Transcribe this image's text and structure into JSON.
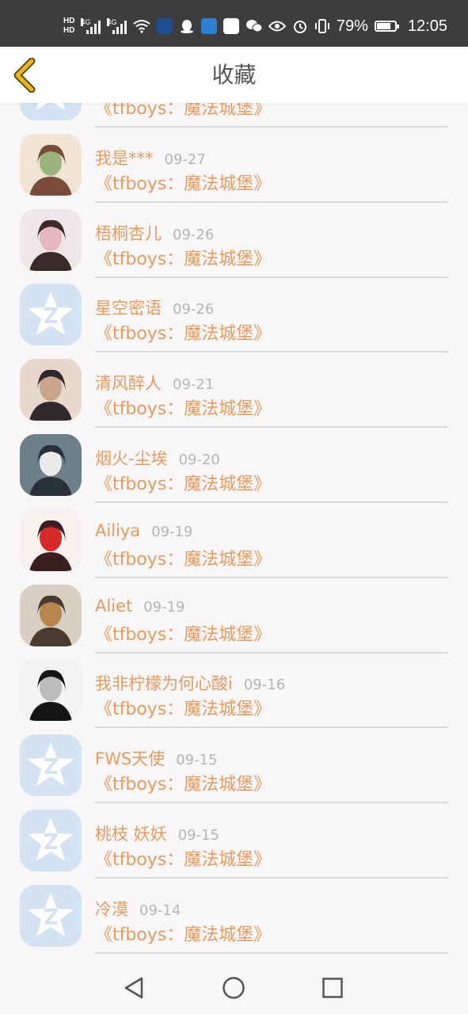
{
  "status_bar": {
    "hd1": "HD",
    "hd2": "HD",
    "sig1_label": "4G",
    "sig2_label": "4G",
    "battery_percent": "79%",
    "battery_level": 0.79,
    "time": "12:05",
    "icons": [
      "wifi-icon",
      "app-icon",
      "qq-icon",
      "app-icon",
      "app-icon",
      "wechat-icon",
      "eye-icon",
      "alarm-icon",
      "vibrate-icon",
      "battery-icon"
    ]
  },
  "header": {
    "title": "收藏",
    "back_icon": "chevron-left-icon",
    "accent": "#e8b422"
  },
  "colors": {
    "accent_orange": "#e69a5e",
    "date_gray": "#b5b5b5",
    "placeholder_avatar": "#d3e3f1"
  },
  "favorites": [
    {
      "name": "",
      "date": "",
      "book": "《tfboys：魔法城堡》",
      "avatar": "qq-default"
    },
    {
      "name": "我是***",
      "date": "09-27",
      "book": "《tfboys：魔法城堡》",
      "avatar": "photo"
    },
    {
      "name": "梧桐杏儿",
      "date": "09-26",
      "book": "《tfboys：魔法城堡》",
      "avatar": "photo"
    },
    {
      "name": "星空密语",
      "date": "09-26",
      "book": "《tfboys：魔法城堡》",
      "avatar": "qq-default"
    },
    {
      "name": "清风醉人",
      "date": "09-21",
      "book": "《tfboys：魔法城堡》",
      "avatar": "photo"
    },
    {
      "name": "烟火-尘埃",
      "date": "09-20",
      "book": "《tfboys：魔法城堡》",
      "avatar": "photo"
    },
    {
      "name": "Ailiya",
      "date": "09-19",
      "book": "《tfboys：魔法城堡》",
      "avatar": "photo"
    },
    {
      "name": "Aliet",
      "date": "09-19",
      "book": "《tfboys：魔法城堡》",
      "avatar": "photo"
    },
    {
      "name": "我非柠檬为何心酸i",
      "date": "09-16",
      "book": "《tfboys：魔法城堡》",
      "avatar": "photo"
    },
    {
      "name": "FWS天使",
      "date": "09-15",
      "book": "《tfboys：魔法城堡》",
      "avatar": "qq-default"
    },
    {
      "name": "桃枝 妖妖",
      "date": "09-15",
      "book": "《tfboys：魔法城堡》",
      "avatar": "qq-default"
    },
    {
      "name": "冷漠",
      "date": "09-14",
      "book": "《tfboys：魔法城堡》",
      "avatar": "qq-default"
    }
  ],
  "nav": {
    "back_icon": "triangle-back-icon",
    "home_icon": "circle-home-icon",
    "recent_icon": "square-recent-icon"
  }
}
